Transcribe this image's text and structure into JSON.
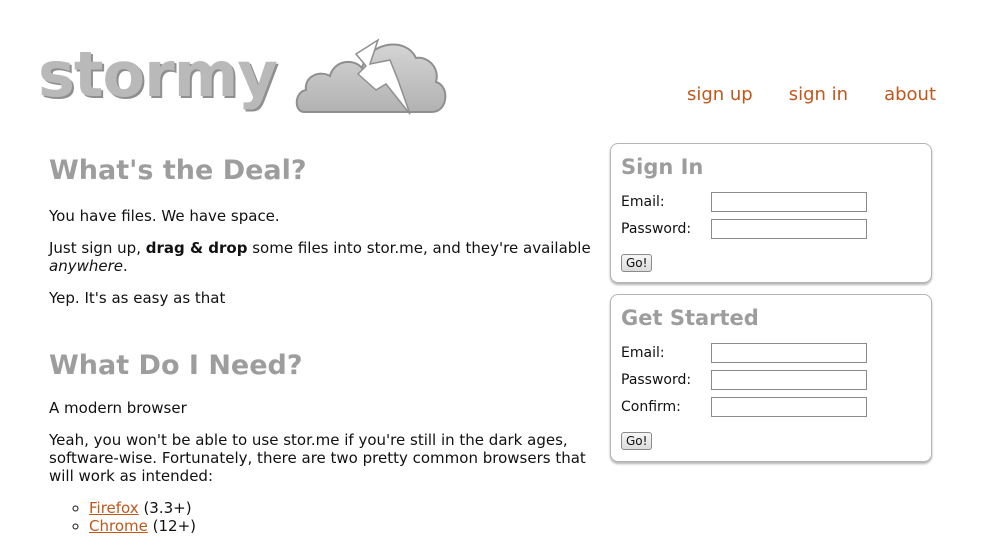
{
  "header": {
    "logo_text": "stormy",
    "nav": {
      "sign_up": "sign up",
      "sign_in": "sign in",
      "about": "about"
    }
  },
  "main": {
    "section1": {
      "title": "What's the Deal?",
      "p1": "You have files. We have space.",
      "p2_start": "Just sign up, ",
      "p2_bold": "drag & drop",
      "p2_mid": " some files into stor.me, and they're available ",
      "p2_em": "anywhere",
      "p2_end": ".",
      "p3": "Yep. It's as easy as that"
    },
    "section2": {
      "title": "What Do I Need?",
      "p1": "A modern browser",
      "p2": "Yeah, you won't be able to use stor.me if you're still in the dark ages, software-wise. Fortunately, there are two pretty common browsers that will work as intended:",
      "browsers": [
        {
          "name": "Firefox",
          "version": "(3.3+)"
        },
        {
          "name": "Chrome",
          "version": "(12+)"
        }
      ]
    }
  },
  "sign_in": {
    "title": "Sign In",
    "email_label": "Email:",
    "password_label": "Password:",
    "email_value": "",
    "password_value": "",
    "submit_label": "Go!"
  },
  "get_started": {
    "title": "Get Started",
    "email_label": "Email:",
    "password_label": "Password:",
    "confirm_label": "Confirm:",
    "email_value": "",
    "password_value": "",
    "confirm_value": "",
    "submit_label": "Go!"
  },
  "colors": {
    "accent": "#c0571b",
    "heading_gray": "#9d9d9d"
  }
}
